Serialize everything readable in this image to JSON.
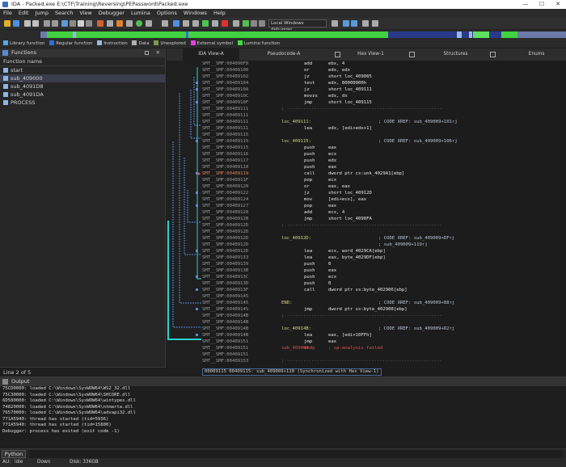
{
  "window": {
    "title": "IDA - Packed.exe E:\\CTF\\Training\\Reversing\\PEPassword\\Packed.exe",
    "minimize": "—",
    "maximize": "☐",
    "close": "✕"
  },
  "menu": [
    "File",
    "Edit",
    "Jump",
    "Search",
    "View",
    "Debugger",
    "Lumina",
    "Options",
    "Windows",
    "Help"
  ],
  "toolbar": {
    "debugger_select": "Local Windows debugger"
  },
  "legend": [
    {
      "label": "Library function",
      "color": "#53a6e8"
    },
    {
      "label": "Regular function",
      "color": "#2f6fd6"
    },
    {
      "label": "Instruction",
      "color": "#9bb8e0"
    },
    {
      "label": "Data",
      "color": "#b0b0b0"
    },
    {
      "label": "Unexplored",
      "color": "#7a9a50"
    },
    {
      "label": "External symbol",
      "color": "#e040e0"
    },
    {
      "label": "Lumina function",
      "color": "#40e040"
    }
  ],
  "functions": {
    "panel_title": "Functions",
    "column_header": "Function name",
    "items": [
      "start",
      "sub_409000",
      "sub_4091D8",
      "sub_4091DA",
      "PROCESS"
    ],
    "selected_index": 1,
    "status": "Line 2 of 5"
  },
  "tabs": [
    "IDA View-A",
    "Pseudocode-A",
    "Hex View-1",
    "Structures",
    "Enums"
  ],
  "disasm": [
    {
      "addr": "SMT__SMF:004090FD",
      "label": "",
      "mn": "add",
      "op": "ebx, 4",
      "cm": ""
    },
    {
      "addr": "SMT__SMF:00409100",
      "label": "",
      "mn": "or",
      "op": "edx, edx",
      "cm": ""
    },
    {
      "addr": "SMT__SMF:00409102",
      "label": "",
      "mn": "jz",
      "op": "short loc_409085",
      "cm": ""
    },
    {
      "addr": "SMT__SMF:00409104",
      "label": "",
      "mn": "test",
      "op": "edx, 80000000h",
      "cm": ""
    },
    {
      "addr": "SMT__SMF:0040910A",
      "label": "",
      "mn": "jz",
      "op": "short loc_409111",
      "cm": ""
    },
    {
      "addr": "SMT__SMF:0040910C",
      "label": "",
      "mn": "movzx",
      "op": "edx, dx",
      "cm": ""
    },
    {
      "addr": "SMT__SMF:0040910F",
      "label": "",
      "mn": "jmp",
      "op": "short loc_409115",
      "cm": ""
    },
    {
      "addr": "SMT__SMF:00409111",
      "label": "",
      "mn": "",
      "op": "",
      "cm": "; ---------------------------------------------------------"
    },
    {
      "addr": "SMT__SMF:00409111",
      "label": "",
      "mn": "",
      "op": "",
      "cm": ""
    },
    {
      "addr": "SMT__SMF:00409111",
      "label": "loc_409111:",
      "mn": "",
      "op": "",
      "cm": "; CODE XREF: sub_409009+101↑j"
    },
    {
      "addr": "SMT__SMF:00409111",
      "label": "",
      "mn": "lea",
      "op": "edx, [edi+edx+1]",
      "cm": ""
    },
    {
      "addr": "SMT__SMF:00409115",
      "label": "",
      "mn": "",
      "op": "",
      "cm": ""
    },
    {
      "addr": "SMT__SMF:00409115",
      "label": "loc_409115:",
      "mn": "",
      "op": "",
      "cm": "; CODE XREF: sub_409009+106↑j"
    },
    {
      "addr": "SMT__SMF:00409115",
      "label": "",
      "mn": "push",
      "op": "eax",
      "cm": ""
    },
    {
      "addr": "SMT__SMF:00409116",
      "label": "",
      "mn": "push",
      "op": "ecx",
      "cm": ""
    },
    {
      "addr": "SMT__SMF:00409117",
      "label": "",
      "mn": "push",
      "op": "edx",
      "cm": ""
    },
    {
      "addr": "SMT__SMF:00409118",
      "label": "",
      "mn": "push",
      "op": "eax",
      "cm": ""
    },
    {
      "addr": "SMT__SMF:00409119",
      "label": "",
      "mn": "call",
      "op": "dword ptr cs:unk_4029A1[ebp]",
      "cm": "",
      "cur": true
    },
    {
      "addr": "SMT__SMF:0040911F",
      "label": "",
      "mn": "pop",
      "op": "ecx",
      "cm": ""
    },
    {
      "addr": "SMT__SMF:00409120",
      "label": "",
      "mn": "or",
      "op": "eax, eax",
      "cm": ""
    },
    {
      "addr": "SMT__SMF:00409122",
      "label": "",
      "mn": "jz",
      "op": "short loc_40912D",
      "cm": ""
    },
    {
      "addr": "SMT__SMF:00409124",
      "label": "",
      "mn": "mov",
      "op": "[edi+ecx], eax",
      "cm": ""
    },
    {
      "addr": "SMT__SMF:00409127",
      "label": "",
      "mn": "pop",
      "op": "eax",
      "cm": ""
    },
    {
      "addr": "SMT__SMF:00409128",
      "label": "",
      "mn": "add",
      "op": "ecx, 4",
      "cm": ""
    },
    {
      "addr": "SMT__SMF:0040912B",
      "label": "",
      "mn": "jmp",
      "op": "short loc_4090FA",
      "cm": ""
    },
    {
      "addr": "SMT__SMF:0040912D",
      "label": "",
      "mn": "",
      "op": "",
      "cm": "; ---------------------------------------------------------"
    },
    {
      "addr": "SMT__SMF:0040912D",
      "label": "",
      "mn": "",
      "op": "",
      "cm": ""
    },
    {
      "addr": "SMT__SMF:0040912D",
      "label": "loc_40912D:",
      "mn": "",
      "op": "",
      "cm": "; CODE XREF: sub_409009+DF↑j"
    },
    {
      "addr": "SMT__SMF:0040912D",
      "label": "",
      "mn": "",
      "op": "",
      "cm": "; sub_409009+119↑j"
    },
    {
      "addr": "SMT__SMF:0040912D",
      "label": "",
      "mn": "lea",
      "op": "ecx, word_4029CA[ebp]",
      "cm": ""
    },
    {
      "addr": "SMT__SMF:00409133",
      "label": "",
      "mn": "lea",
      "op": "eax, byte_4029DF[ebp]",
      "cm": ""
    },
    {
      "addr": "SMT__SMF:00409139",
      "label": "",
      "mn": "push",
      "op": "0",
      "cm": ""
    },
    {
      "addr": "SMT__SMF:0040913B",
      "label": "",
      "mn": "push",
      "op": "eax",
      "cm": ""
    },
    {
      "addr": "SMT__SMF:0040913C",
      "label": "",
      "mn": "push",
      "op": "ecx",
      "cm": ""
    },
    {
      "addr": "SMT__SMF:0040913D",
      "label": "",
      "mn": "push",
      "op": "0",
      "cm": ""
    },
    {
      "addr": "SMT__SMF:0040913F",
      "label": "",
      "mn": "call",
      "op": "dword ptr ss:byte_402906[ebp]",
      "cm": ""
    },
    {
      "addr": "SMT__SMF:00409145",
      "label": "",
      "mn": "",
      "op": "",
      "cm": ""
    },
    {
      "addr": "SMT__SMF:00409145",
      "label": "END:",
      "mn": "",
      "op": "",
      "cm": "; CODE XREF: sub_409009+88↑j"
    },
    {
      "addr": "SMT__SMF:00409145",
      "label": "",
      "mn": "jmp",
      "op": "dword ptr ss:byte_402908[ebp]",
      "cm": ""
    },
    {
      "addr": "SMT__SMF:0040914B",
      "label": "",
      "mn": "",
      "op": "",
      "cm": "; ---------------------------------------------------------"
    },
    {
      "addr": "SMT__SMF:0040914B",
      "label": "",
      "mn": "",
      "op": "",
      "cm": ""
    },
    {
      "addr": "SMT__SMF:0040914B",
      "label": "loc_40914B:",
      "mn": "",
      "op": "",
      "cm": "; CODE XREF: sub_409009+D2↑j"
    },
    {
      "addr": "SMT__SMF:0040914B",
      "label": "",
      "mn": "lea",
      "op": "eax, [edi+10FFh]",
      "cm": ""
    },
    {
      "addr": "SMT__SMF:00409151",
      "label": "",
      "mn": "jmp",
      "op": "eax",
      "cm": ""
    },
    {
      "addr": "SMT__SMF:00409151",
      "label": "sub_409009",
      "mn": "endp",
      "op": "; sp-analysis failed",
      "cm": ""
    },
    {
      "addr": "SMT__SMF:00409151",
      "label": "",
      "mn": "",
      "op": "",
      "cm": ""
    },
    {
      "addr": "SMT__SMF:00409153",
      "label": "",
      "mn": "",
      "op": "",
      "cm": "; ---------------------------------------------------------"
    }
  ],
  "sync_status": "00009115 00409115: sub_409009+110 (Synchronized with Hex View-1)",
  "output": {
    "title": "Output",
    "lines": [
      "75CD0000: loaded C:\\Windows\\SysWOW64\\WS2_32.dll",
      "75C30000: loaded C:\\Windows\\SysWOW64\\SHCORE.dll",
      "6D580000: loaded C:\\Windows\\SysWOW64\\wintypes.dll",
      "74820000: loaded C:\\Windows\\SysWOW64\\ntmarta.dll",
      "76570000: loaded C:\\Windows\\SysWOW64\\advapi32.dll",
      "771A5940: thread has started (tid=5936)",
      "771A5940: thread has started (tid=15800)",
      "Debugger: process has exited (exit code -1)"
    ]
  },
  "python_button": "Python",
  "status": {
    "mode": "AU:",
    "state": "idle",
    "direction": "Down",
    "disk": "Disk: 336GB"
  }
}
